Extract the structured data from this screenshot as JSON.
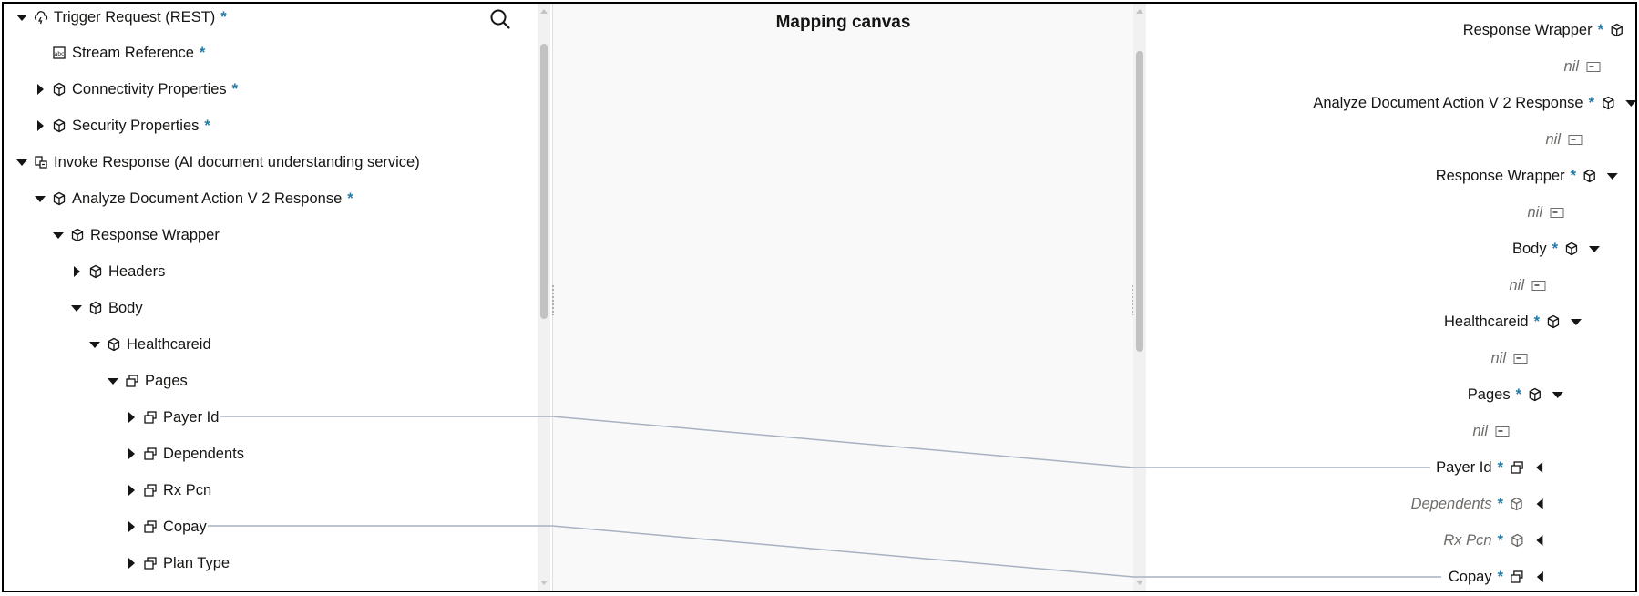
{
  "source_tree": {
    "search_icon": "search-icon",
    "items": [
      {
        "label": "Trigger Request (REST)",
        "required": "*"
      },
      {
        "label": "Stream Reference",
        "required": "*"
      },
      {
        "label": "Connectivity Properties",
        "required": "*"
      },
      {
        "label": "Security Properties",
        "required": "*"
      },
      {
        "label": "Invoke Response (AI document understanding service)",
        "required": ""
      },
      {
        "label": "Analyze Document Action V 2 Response",
        "required": "*"
      },
      {
        "label": "Response Wrapper",
        "required": ""
      },
      {
        "label": "Headers",
        "required": ""
      },
      {
        "label": "Body",
        "required": ""
      },
      {
        "label": "Healthcareid",
        "required": ""
      },
      {
        "label": "Pages",
        "required": ""
      },
      {
        "label": "Payer Id",
        "required": ""
      },
      {
        "label": "Dependents",
        "required": ""
      },
      {
        "label": "Rx Pcn",
        "required": ""
      },
      {
        "label": "Copay",
        "required": ""
      },
      {
        "label": "Plan Type",
        "required": ""
      }
    ]
  },
  "canvas": {
    "title": "Mapping canvas"
  },
  "target_tree": {
    "items": [
      {
        "label": "Response Wrapper",
        "required": "*"
      },
      {
        "label": "nil"
      },
      {
        "label": "Analyze Document Action V 2 Response",
        "required": "*"
      },
      {
        "label": "nil"
      },
      {
        "label": "Response Wrapper",
        "required": "*"
      },
      {
        "label": "nil"
      },
      {
        "label": "Body",
        "required": "*"
      },
      {
        "label": "nil"
      },
      {
        "label": "Healthcareid",
        "required": "*"
      },
      {
        "label": "nil"
      },
      {
        "label": "Pages",
        "required": "*"
      },
      {
        "label": "nil"
      },
      {
        "label": "Payer Id",
        "required": "*"
      },
      {
        "label": "Dependents",
        "required": "*"
      },
      {
        "label": "Rx Pcn",
        "required": "*"
      },
      {
        "label": "Copay",
        "required": "*"
      }
    ]
  },
  "mappings": [
    {
      "source": "Payer Id",
      "target": "Payer Id"
    },
    {
      "source": "Copay",
      "target": "Copay"
    }
  ],
  "colors": {
    "required_star": "#227ba8",
    "mapping_line": "#a7b2c2"
  }
}
